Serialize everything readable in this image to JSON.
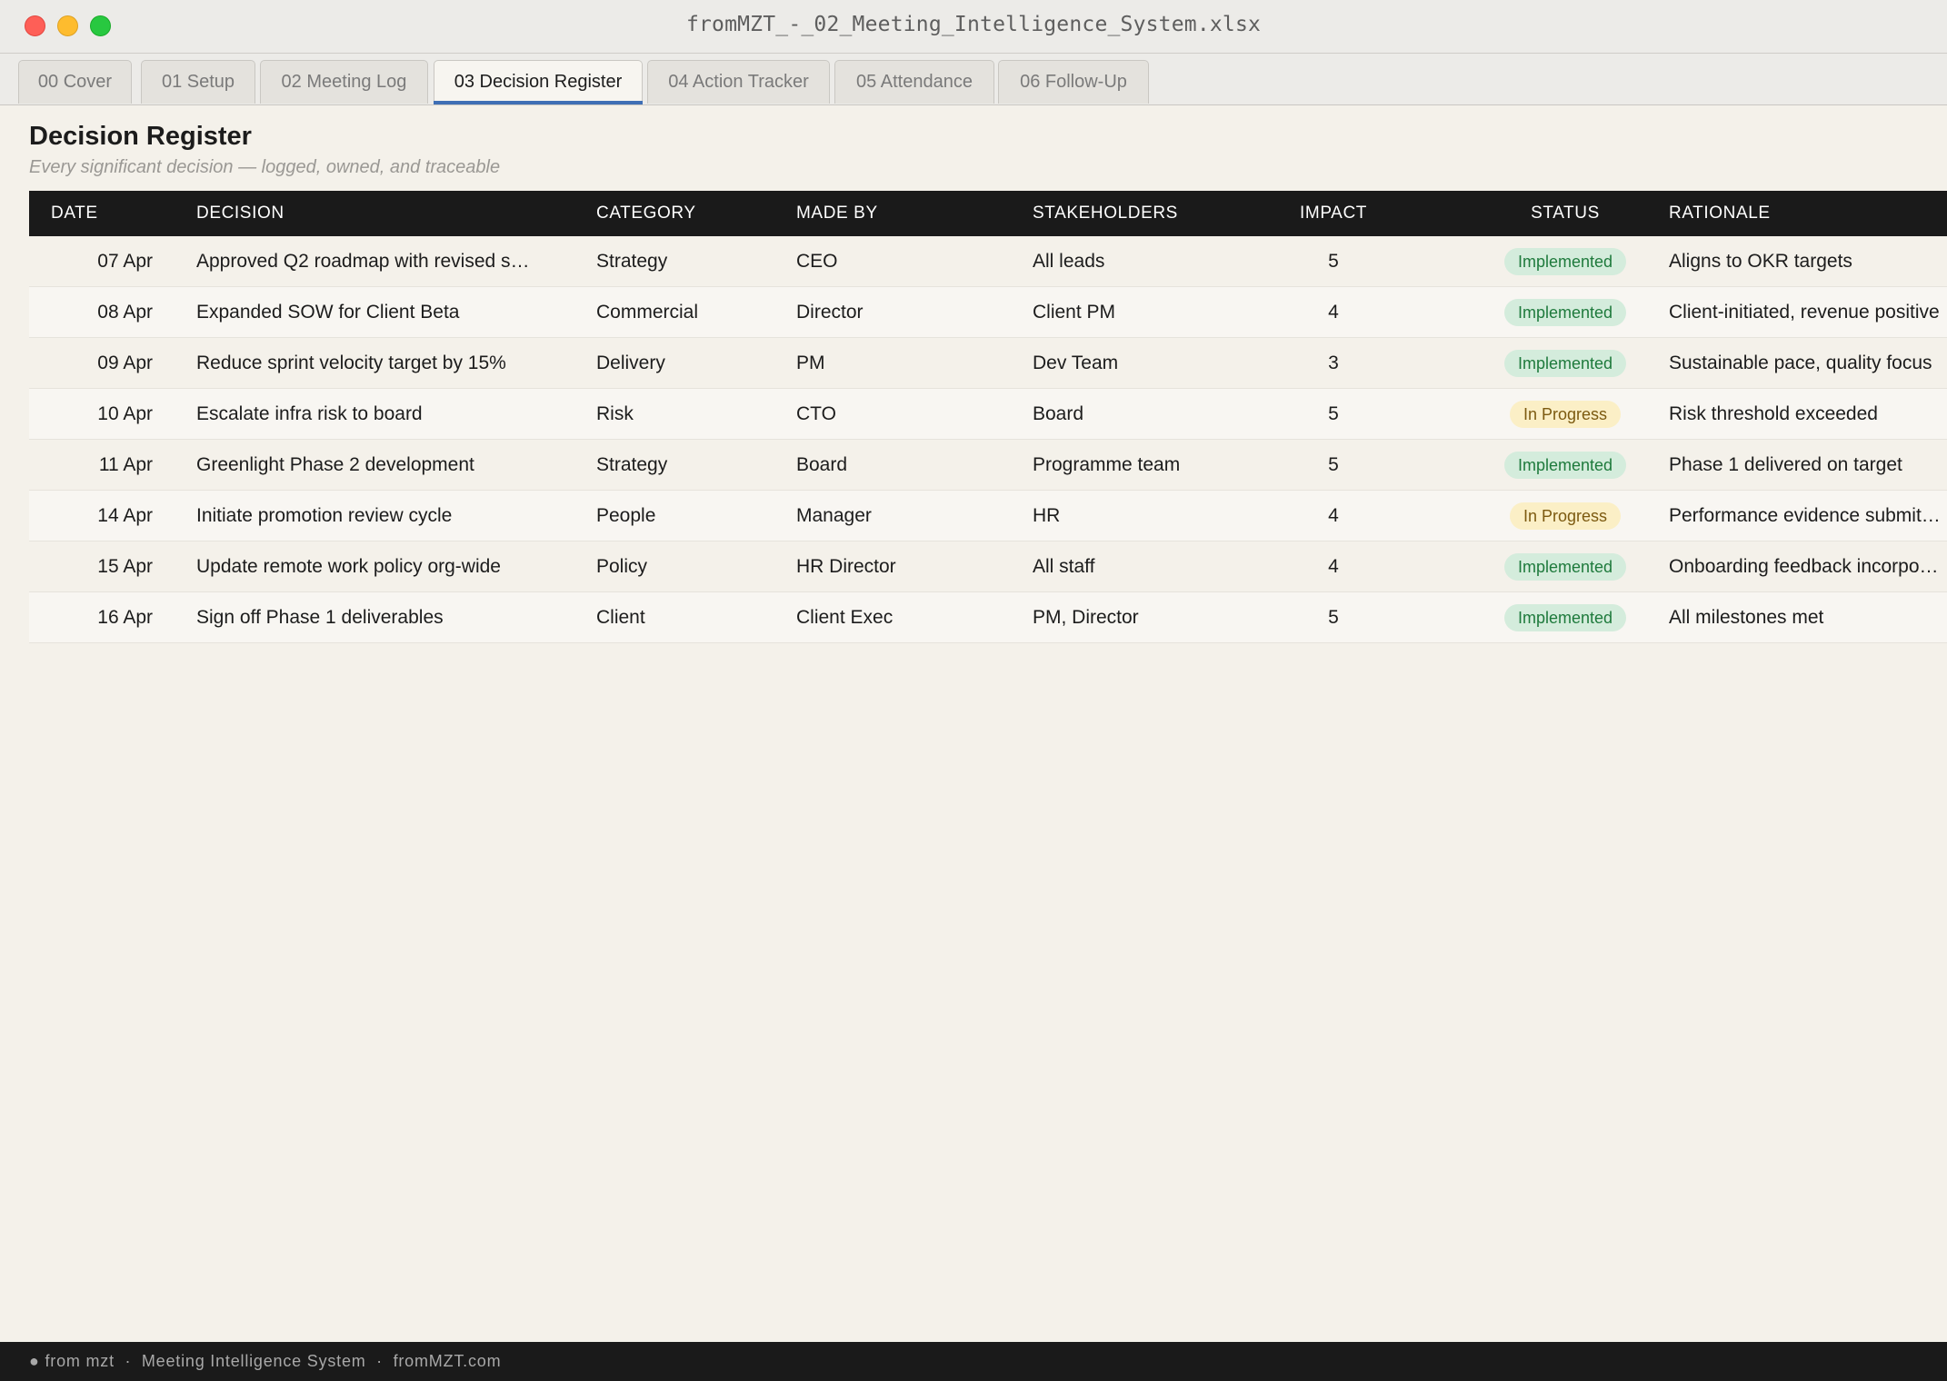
{
  "window": {
    "title": "fromMZT_-_02_Meeting_Intelligence_System.xlsx"
  },
  "tabs": [
    {
      "label": "00 Cover"
    },
    {
      "label": "01 Setup"
    },
    {
      "label": "02 Meeting Log"
    },
    {
      "label": "03 Decision Register",
      "active": true
    },
    {
      "label": "04 Action Tracker"
    },
    {
      "label": "05 Attendance"
    },
    {
      "label": "06 Follow-Up"
    }
  ],
  "sheet": {
    "title": "Decision Register",
    "subtitle": "Every significant decision — logged, owned, and traceable"
  },
  "table": {
    "columns": [
      "DATE",
      "DECISION",
      "CATEGORY",
      "MADE BY",
      "STAKEHOLDERS",
      "IMPACT",
      "STATUS",
      "RATIONALE"
    ],
    "rows": [
      {
        "date": "07 Apr",
        "decision": "Approved Q2 roadmap with revised s…",
        "category": "Strategy",
        "made_by": "CEO",
        "stakeholders": "All leads",
        "impact": "5",
        "status": "Implemented",
        "rationale": "Aligns to OKR targets"
      },
      {
        "date": "08 Apr",
        "decision": "Expanded SOW for Client Beta",
        "category": "Commercial",
        "made_by": "Director",
        "stakeholders": "Client PM",
        "impact": "4",
        "status": "Implemented",
        "rationale": "Client-initiated, revenue positive"
      },
      {
        "date": "09 Apr",
        "decision": "Reduce sprint velocity target by 15%",
        "category": "Delivery",
        "made_by": "PM",
        "stakeholders": "Dev Team",
        "impact": "3",
        "status": "Implemented",
        "rationale": "Sustainable pace, quality focus"
      },
      {
        "date": "10 Apr",
        "decision": "Escalate infra risk to board",
        "category": "Risk",
        "made_by": "CTO",
        "stakeholders": "Board",
        "impact": "5",
        "status": "In Progress",
        "rationale": "Risk threshold exceeded"
      },
      {
        "date": "11 Apr",
        "decision": "Greenlight Phase 2 development",
        "category": "Strategy",
        "made_by": "Board",
        "stakeholders": "Programme team",
        "impact": "5",
        "status": "Implemented",
        "rationale": "Phase 1 delivered on target"
      },
      {
        "date": "14 Apr",
        "decision": "Initiate promotion review cycle",
        "category": "People",
        "made_by": "Manager",
        "stakeholders": "HR",
        "impact": "4",
        "status": "In Progress",
        "rationale": "Performance evidence submit…"
      },
      {
        "date": "15 Apr",
        "decision": "Update remote work policy org-wide",
        "category": "Policy",
        "made_by": "HR Director",
        "stakeholders": "All staff",
        "impact": "4",
        "status": "Implemented",
        "rationale": "Onboarding feedback incorpo…"
      },
      {
        "date": "16 Apr",
        "decision": "Sign off Phase 1 deliverables",
        "category": "Client",
        "made_by": "Client Exec",
        "stakeholders": "PM, Director",
        "impact": "5",
        "status": "Implemented",
        "rationale": "All milestones met"
      }
    ]
  },
  "footer": {
    "text": "● from mzt  ·  Meeting Intelligence System  ·  fromMZT.com"
  },
  "colors": {
    "accent": "#3f6fb5",
    "header_bg": "#1a1a1a",
    "implemented_bg": "#d4ecdc",
    "implemented_text": "#1e7a3c",
    "in_progress_bg": "#fbefc6",
    "in_progress_text": "#7c5a10"
  }
}
